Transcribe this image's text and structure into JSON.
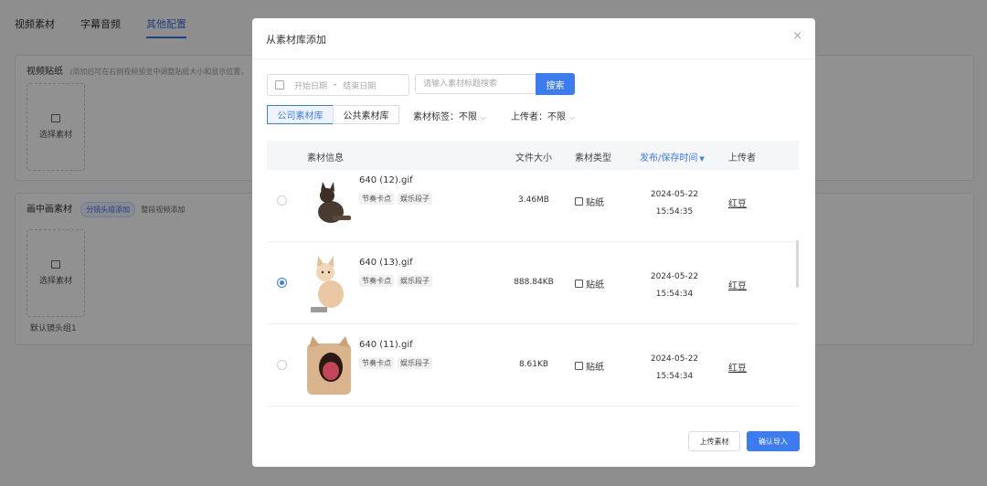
{
  "background": {
    "tabs": [
      {
        "label": "视频素材"
      },
      {
        "label": "字幕音频"
      },
      {
        "label": "其他配置"
      }
    ],
    "sticker_section": {
      "title": "视频贴纸",
      "hint": "(添加后可在右侧视频预览中调整贴纸大小和显示位置，"
    },
    "pip_section": {
      "title": "画中画素材",
      "chip_active": "分镜头组添加",
      "chip_other": "整段视频添加",
      "default_group": "默认镜头组1"
    },
    "select_material_label": "选择素材"
  },
  "modal": {
    "title": "从素材库添加",
    "close_icon": "×",
    "date_start_placeholder": "开始日期",
    "date_separator": "-",
    "date_end_placeholder": "结束日期",
    "search_placeholder": "请输入素材标题搜索",
    "search_button": "搜索",
    "library_tabs": [
      {
        "label": "公司素材库",
        "active": true
      },
      {
        "label": "公共素材库",
        "active": false
      }
    ],
    "filters": [
      {
        "label": "素材标签：不限"
      },
      {
        "label": "上传者：不限"
      }
    ],
    "columns": {
      "info": "素材信息",
      "size": "文件大小",
      "type": "素材类型",
      "date": "发布/保存时间",
      "uploader": "上传者"
    },
    "rows": [
      {
        "name": "640 (12).gif",
        "tags": [
          "节奏卡点",
          "娱乐段子"
        ],
        "size": "3.46MB",
        "type": "贴纸",
        "date": "2024-05-22",
        "time": "15:54:35",
        "uploader": "红豆",
        "selected": false
      },
      {
        "name": "640 (13).gif",
        "tags": [
          "节奏卡点",
          "娱乐段子"
        ],
        "size": "888.84KB",
        "type": "贴纸",
        "date": "2024-05-22",
        "time": "15:54:34",
        "uploader": "红豆",
        "selected": true
      },
      {
        "name": "640 (11).gif",
        "tags": [
          "节奏卡点",
          "娱乐段子"
        ],
        "size": "8.61KB",
        "type": "贴纸",
        "date": "2024-05-22",
        "time": "15:54:34",
        "uploader": "红豆",
        "selected": false
      }
    ],
    "upload_button": "上传素材",
    "confirm_button": "确认导入"
  },
  "colors": {
    "accent": "#3b7cf0"
  }
}
